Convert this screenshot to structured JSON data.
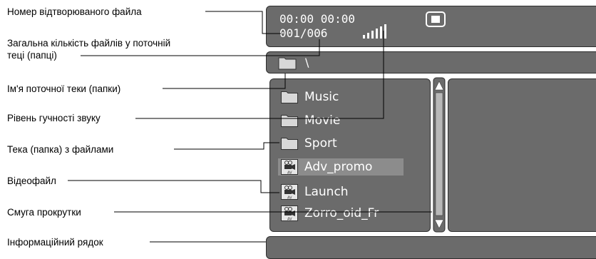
{
  "callouts": {
    "track_number": "Номер відтворюваного файла",
    "total_files_l1": "Загальна кількість файлів у поточній",
    "total_files_l2": "теці (папці)",
    "folder_name": "Ім'я поточної теки (папки)",
    "volume_level": "Рівень гучності звуку",
    "folder_with_files": "Тека (папка) з файлами",
    "video_file": "Відеофайл",
    "scrollbar": "Смуга прокрутки",
    "info_line": "Інформаційний рядок"
  },
  "osd": {
    "time": "00:00  00:00",
    "counter": "001/006",
    "volume_icon": "volume-bars-icon",
    "stop_icon": "stop-icon"
  },
  "path": {
    "text": "\\"
  },
  "files": [
    {
      "name": "Music",
      "type": "folder"
    },
    {
      "name": "Movie",
      "type": "folder"
    },
    {
      "name": "Sport",
      "type": "folder"
    },
    {
      "name": "Adv_promo",
      "type": "video",
      "selected": true
    },
    {
      "name": "Launch",
      "type": "video"
    },
    {
      "name": "Zorro_oid_Fr",
      "type": "video"
    }
  ],
  "colors": {
    "panel": "#6b6b6b",
    "panel_border": "#2e2e2e",
    "selection": "#8c8c8c",
    "osd_text": "#ffffff",
    "callout_line": "#000000"
  }
}
